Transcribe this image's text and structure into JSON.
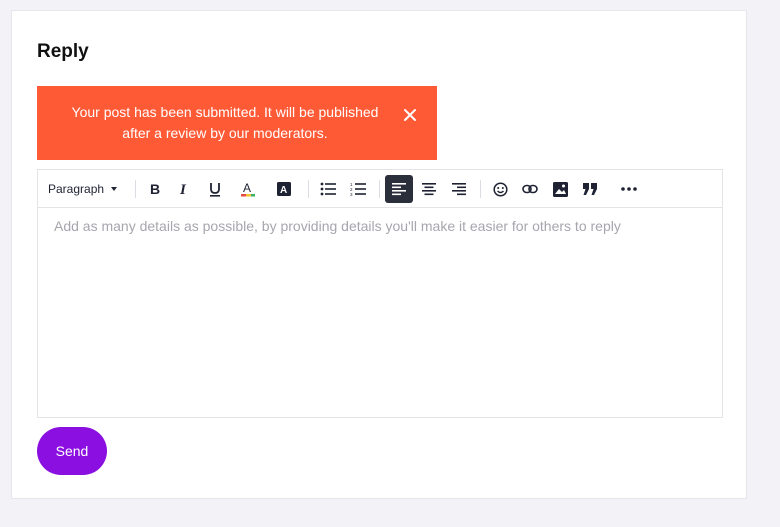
{
  "reply": {
    "title": "Reply"
  },
  "toast": {
    "message": "Your post has been submitted. It will be published after a review by our moderators.",
    "close_icon": "close-icon",
    "background": "#ff5a36"
  },
  "toolbar": {
    "block_format": "Paragraph",
    "buttons": [
      "bold-icon",
      "italic-icon",
      "underline-icon",
      "font-color-icon",
      "background-color-icon",
      "bullet-list-icon",
      "numbered-list-icon",
      "align-left-icon",
      "align-center-icon",
      "align-right-icon",
      "emoji-icon",
      "link-icon",
      "image-icon",
      "quote-icon",
      "more-icon"
    ],
    "active": "align-left-icon"
  },
  "editor": {
    "placeholder": "Add as many details as possible, by providing details you'll make it easier for others to reply",
    "value": ""
  },
  "send": {
    "label": "Send",
    "color": "#8a0fe0"
  }
}
